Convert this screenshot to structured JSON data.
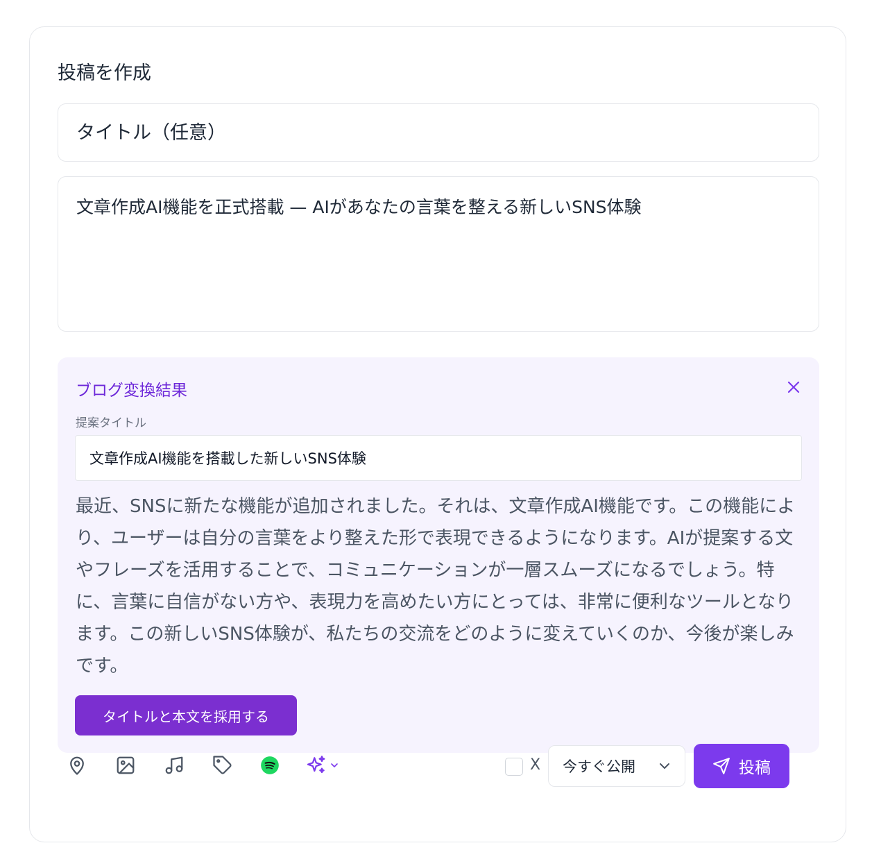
{
  "composer": {
    "heading": "投稿を作成",
    "title_placeholder": "タイトル（任意）",
    "body_value": "文章作成AI機能を正式搭載 — AIがあなたの言葉を整える新しいSNS体験"
  },
  "ai_result": {
    "heading": "ブログ変換結果",
    "close_icon": "close-icon",
    "suggested_title_label": "提案タイトル",
    "suggested_title": "文章作成AI機能を搭載した新しいSNS体験",
    "body": "最近、SNSに新たな機能が追加されました。それは、文章作成AI機能です。この機能により、ユーザーは自分の言葉をより整えた形で表現できるようになります。AIが提案する文やフレーズを活用することで、コミュニケーションが一層スムーズになるでしょう。特に、言葉に自信がない方や、表現力を高めたい方にとっては、非常に便利なツールとなります。この新しいSNS体験が、私たちの交流をどのように変えていくのか、今後が楽しみです。",
    "adopt_label": "タイトルと本文を採用する"
  },
  "toolbar": {
    "icons": [
      "location-pin-icon",
      "image-icon",
      "music-icon",
      "tag-icon",
      "spotify-icon",
      "ai-sparkles-icon"
    ],
    "x_label": "X",
    "x_checked": false,
    "publish_option": "今すぐ公開",
    "post_label": "投稿"
  },
  "colors": {
    "accent": "#7c3aed",
    "accent_dark": "#6d28d9",
    "panel_bg": "#f6f3fe",
    "spotify": "#1ed760"
  }
}
